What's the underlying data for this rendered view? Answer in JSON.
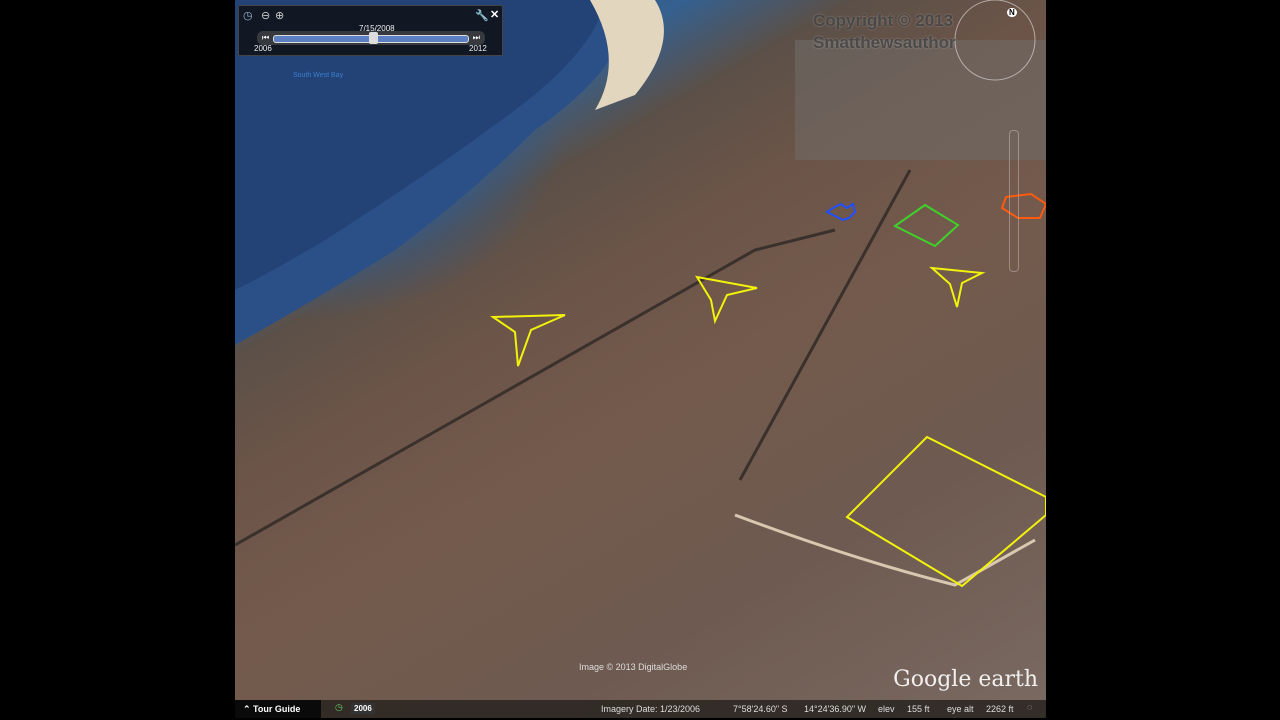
{
  "time_slider": {
    "current_date": "7/15/2008",
    "start_year": "2006",
    "end_year": "2012"
  },
  "map": {
    "place_label": "South West Bay",
    "copyright_overlay": [
      "Copyright © 2013",
      "Smatthewsauthor"
    ],
    "imagery_credit": "Image © 2013 DigitalGlobe",
    "logo": "Google earth",
    "compass_label": "N"
  },
  "status_bar": {
    "tour_guide": "Tour Guide",
    "historical_year": "2006",
    "imagery_date": "Imagery Date: 1/23/2006",
    "latitude": "7°58'24.60\" S",
    "longitude": "14°24'36.90\" W",
    "elev_label": "elev",
    "elev": "155 ft",
    "eye_alt_label": "eye alt",
    "eye_alt": "2262 ft"
  },
  "colors": {
    "yellow": "#f2f20a",
    "green": "#3fd02a",
    "blue": "#2050ff",
    "orange": "#ff5a10"
  }
}
